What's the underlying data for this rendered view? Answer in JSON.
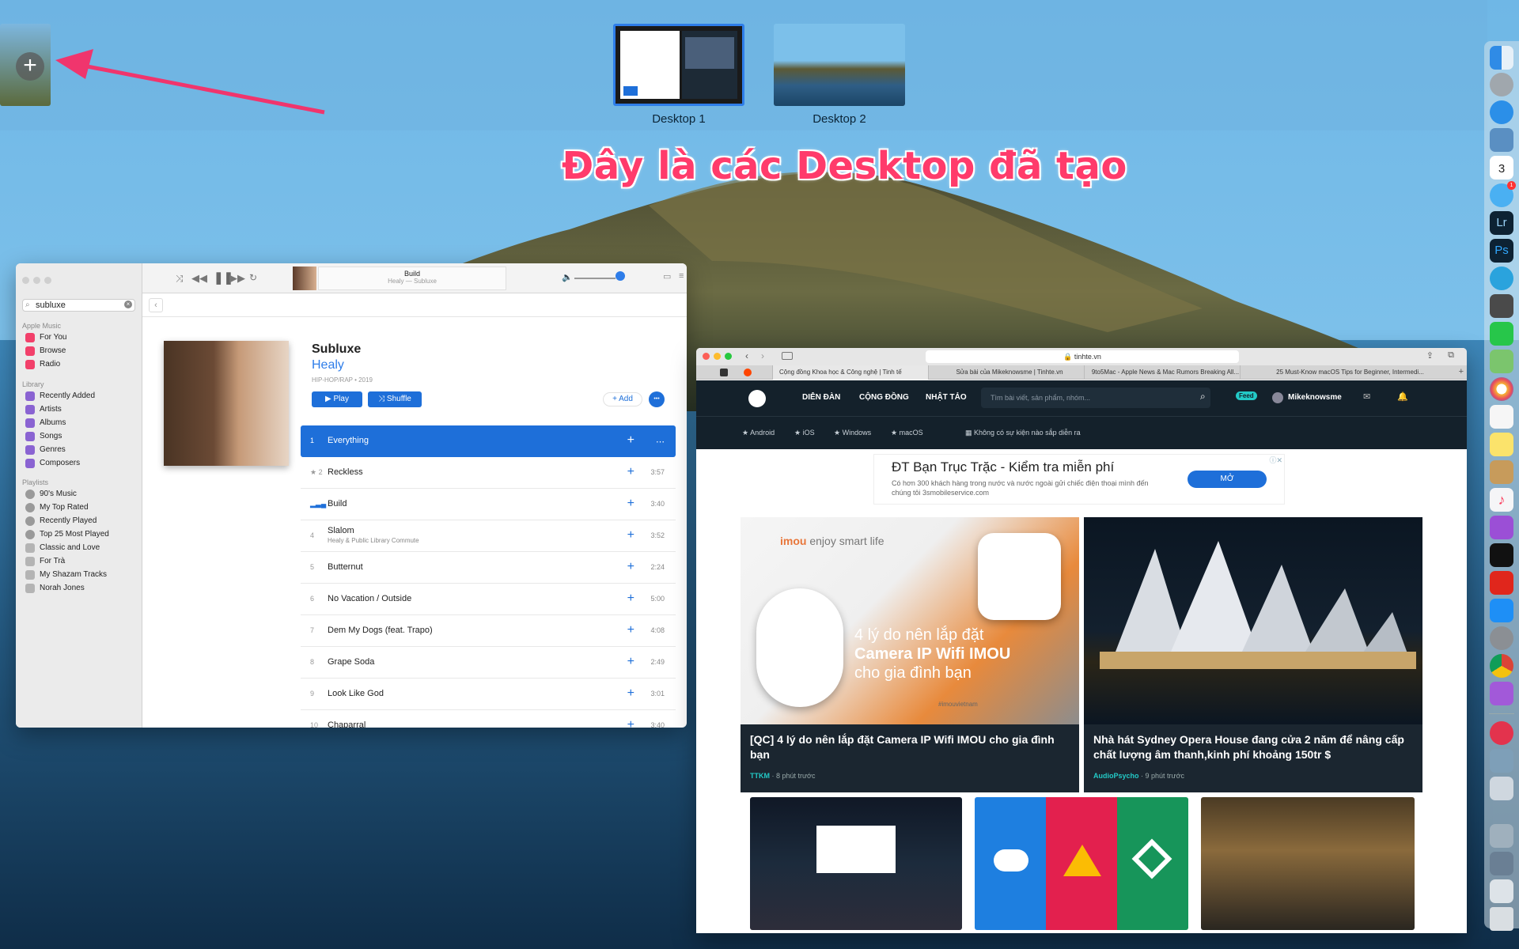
{
  "spaces": {
    "desktops": [
      {
        "label": "Desktop 1"
      },
      {
        "label": "Desktop 2"
      }
    ],
    "add_label": "+",
    "caption": "Đây là các Desktop đã tạo"
  },
  "music": {
    "now_playing": {
      "title": "Build",
      "subtitle": "Healy — Subluxe"
    },
    "search_value": "subluxe",
    "sidebar": {
      "apple_music_header": "Apple Music",
      "apple_music": [
        "For You",
        "Browse",
        "Radio"
      ],
      "library_header": "Library",
      "library": [
        "Recently Added",
        "Artists",
        "Albums",
        "Songs",
        "Genres",
        "Composers"
      ],
      "playlists_header": "Playlists",
      "playlists": [
        "90's Music",
        "My Top Rated",
        "Recently Played",
        "Top 25 Most Played",
        "Classic and Love",
        "For Trà",
        "My Shazam Tracks",
        "Norah Jones"
      ]
    },
    "album": {
      "title": "Subluxe",
      "artist": "Healy",
      "meta": "HIP-HOP/RAP • 2019",
      "play_label": "▶ Play",
      "shuffle_label": "⤨ Shuffle",
      "add_label": "+ Add",
      "more_label": "•••"
    },
    "tracks": [
      {
        "num": "1",
        "title": "Everything",
        "sub": "",
        "dur": "",
        "selected": true
      },
      {
        "num": "★ 2",
        "title": "Reckless",
        "sub": "",
        "dur": "3:57"
      },
      {
        "num": "",
        "title": "Build",
        "sub": "",
        "dur": "3:40"
      },
      {
        "num": "4",
        "title": "Slalom",
        "sub": "Healy & Public Library Commute",
        "dur": "3:52"
      },
      {
        "num": "5",
        "title": "Butternut",
        "sub": "",
        "dur": "2:24"
      },
      {
        "num": "6",
        "title": "No Vacation / Outside",
        "sub": "",
        "dur": "5:00"
      },
      {
        "num": "7",
        "title": "Dem My Dogs (feat. Trapo)",
        "sub": "",
        "dur": "4:08"
      },
      {
        "num": "8",
        "title": "Grape Soda",
        "sub": "",
        "dur": "2:49"
      },
      {
        "num": "9",
        "title": "Look Like God",
        "sub": "",
        "dur": "3:01"
      },
      {
        "num": "10",
        "title": "Chaparral",
        "sub": "",
        "dur": "3:40"
      }
    ]
  },
  "safari": {
    "url": "tinhte.vn",
    "tabs": [
      "Cộng đồng Khoa học & Công nghệ | Tinh tế",
      "Sửa bài của Mikeknowsme | Tinhte.vn",
      "9to5Mac - Apple News & Mac Rumors Breaking All...",
      "25 Must-Know macOS Tips for Beginner, Intermedi..."
    ],
    "nav": [
      "DIỄN ĐÀN",
      "CỘNG ĐỒNG",
      "NHẬT TẢO"
    ],
    "search_placeholder": "Tìm bài viết, sản phẩm, nhóm...",
    "feed_label": "Feed",
    "user": "Mikeknowsme",
    "subnav": [
      "Android",
      "iOS",
      "Windows",
      "macOS"
    ],
    "event": "Không có sự kiện nào sắp diễn ra",
    "ad": {
      "title": "ĐT Bạn Trục Trặc - Kiểm tra miễn phí",
      "body": "Có hơn 300 khách hàng trong nước và nước ngoài gửi chiếc điện thoại mình đến chúng tôi 3smobileservice.com",
      "button": "MỞ"
    },
    "cards": [
      {
        "title": "[QC] 4 lý do nên lắp đặt Camera IP Wifi IMOU cho gia đình bạn",
        "author": "TTKM",
        "time": "· 8 phút trước",
        "image_text": {
          "brand": "imou",
          "tagline": "enjoy smart life",
          "line1": "4 lý do nên lắp đặt",
          "line2": "Camera IP Wifi IMOU",
          "line3": "cho gia đình bạn",
          "hashtag": "#imouvietnam"
        }
      },
      {
        "title": "Nhà hát Sydney Opera House đang cửa 2 năm để nâng cấp chất lượng âm thanh,kinh phí khoảng 150tr $",
        "author": "AudioPsycho",
        "time": "· 9 phút trước"
      }
    ]
  },
  "dock": {
    "badges": {
      "calendar_day": "3",
      "messages": "1"
    },
    "lr_label": "Lr",
    "ps_label": "Ps"
  }
}
